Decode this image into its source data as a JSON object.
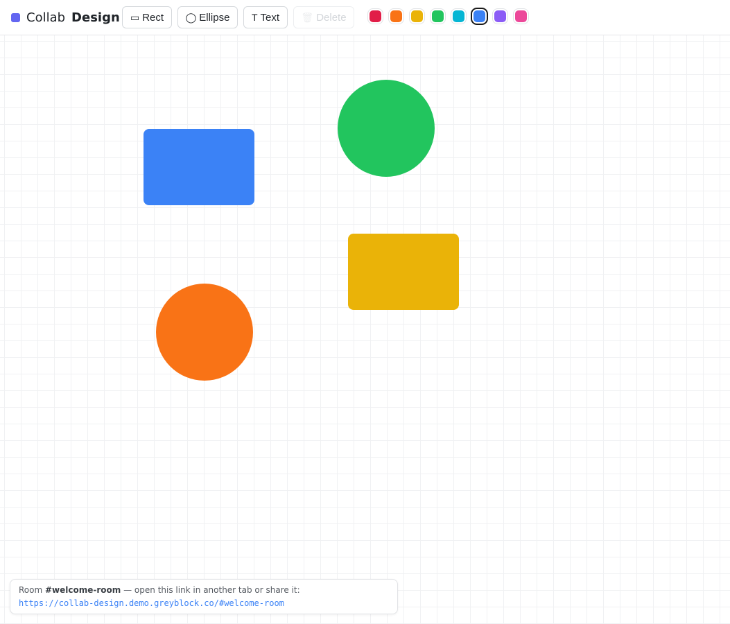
{
  "app": {
    "title_light": "Collab",
    "title_bold": "Design",
    "logo_color": "#6366f1"
  },
  "toolbar": {
    "tools": [
      {
        "id": "rect",
        "label": "Rect",
        "icon": "rectangle-icon",
        "glyph": "▭",
        "enabled": true
      },
      {
        "id": "ellipse",
        "label": "Ellipse",
        "icon": "circle-icon",
        "glyph": "◯",
        "enabled": true
      },
      {
        "id": "text",
        "label": "Text",
        "icon": "text-icon",
        "glyph": "T",
        "enabled": true
      },
      {
        "id": "delete",
        "label": "Delete",
        "icon": "trash-icon",
        "glyph": "🗑",
        "enabled": false
      }
    ],
    "colors": [
      {
        "name": "red",
        "hex": "#e11d48",
        "selected": false
      },
      {
        "name": "orange",
        "hex": "#f97316",
        "selected": false
      },
      {
        "name": "yellow",
        "hex": "#eab308",
        "selected": false
      },
      {
        "name": "green",
        "hex": "#22c55e",
        "selected": false
      },
      {
        "name": "cyan",
        "hex": "#06b6d4",
        "selected": false
      },
      {
        "name": "blue",
        "hex": "#3b82f6",
        "selected": true
      },
      {
        "name": "purple",
        "hex": "#8b5cf6",
        "selected": false
      },
      {
        "name": "pink",
        "hex": "#ec4899",
        "selected": false
      }
    ]
  },
  "canvas": {
    "shapes": [
      {
        "type": "rect",
        "color": "#3b82f6"
      },
      {
        "type": "ellipse",
        "color": "#22c55e"
      },
      {
        "type": "rect",
        "color": "#eab308"
      },
      {
        "type": "ellipse",
        "color": "#f97316"
      }
    ]
  },
  "room": {
    "prefix": "Room ",
    "name": "#welcome-room",
    "suffix": " — open this link in another tab or share it:",
    "link": "https://collab-design.demo.greyblock.co/#welcome-room"
  }
}
